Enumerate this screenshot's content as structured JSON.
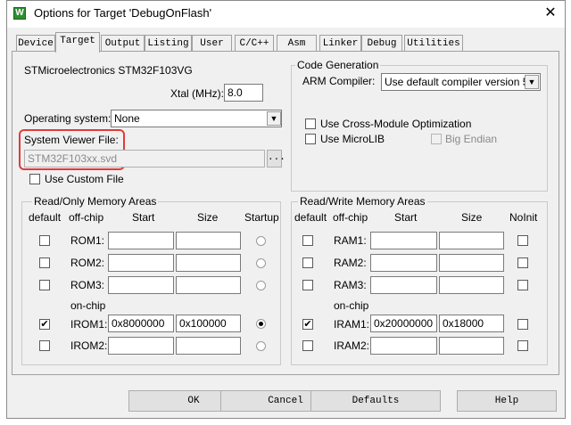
{
  "window": {
    "title": "Options for Target 'DebugOnFlash'",
    "close": "✕",
    "app_icon": "W"
  },
  "tabs": [
    {
      "label": "Device"
    },
    {
      "label": "Target"
    },
    {
      "label": "Output"
    },
    {
      "label": "Listing"
    },
    {
      "label": "User"
    },
    {
      "label": "C/C++"
    },
    {
      "label": "Asm"
    },
    {
      "label": "Linker"
    },
    {
      "label": "Debug"
    },
    {
      "label": "Utilities"
    }
  ],
  "device": {
    "name": "STMicroelectronics STM32F103VG",
    "xtal_label": "Xtal (MHz):",
    "xtal_value": "8.0"
  },
  "os": {
    "label": "Operating system:",
    "value": "None"
  },
  "svd": {
    "label": "System Viewer File:",
    "value": "STM32F103xx.svd",
    "browse": "...",
    "use_custom_label": "Use Custom File"
  },
  "codegen": {
    "title": "Code Generation",
    "compiler_label": "ARM Compiler:",
    "compiler_value": "Use default compiler version 5",
    "cross_module": "Use Cross-Module Optimization",
    "microlib": "Use MicroLIB",
    "big_endian": "Big Endian"
  },
  "ro": {
    "title": "Read/Only Memory Areas",
    "headers": {
      "default": "default",
      "offchip": "off-chip",
      "start": "Start",
      "size": "Size",
      "startup": "Startup"
    },
    "onchip": "on-chip",
    "rows": [
      {
        "name": "ROM1:",
        "start": "",
        "size": "",
        "checked": false,
        "startup": false
      },
      {
        "name": "ROM2:",
        "start": "",
        "size": "",
        "checked": false,
        "startup": false
      },
      {
        "name": "ROM3:",
        "start": "",
        "size": "",
        "checked": false,
        "startup": false
      },
      {
        "name": "IROM1:",
        "start": "0x8000000",
        "size": "0x100000",
        "checked": true,
        "startup": true
      },
      {
        "name": "IROM2:",
        "start": "",
        "size": "",
        "checked": false,
        "startup": false
      }
    ]
  },
  "rw": {
    "title": "Read/Write Memory Areas",
    "headers": {
      "default": "default",
      "offchip": "off-chip",
      "start": "Start",
      "size": "Size",
      "noinit": "NoInit"
    },
    "onchip": "on-chip",
    "rows": [
      {
        "name": "RAM1:",
        "start": "",
        "size": "",
        "checked": false
      },
      {
        "name": "RAM2:",
        "start": "",
        "size": "",
        "checked": false
      },
      {
        "name": "RAM3:",
        "start": "",
        "size": "",
        "checked": false
      },
      {
        "name": "IRAM1:",
        "start": "0x20000000",
        "size": "0x18000",
        "checked": true
      },
      {
        "name": "IRAM2:",
        "start": "",
        "size": "",
        "checked": false
      }
    ]
  },
  "buttons": {
    "ok": "OK",
    "cancel": "Cancel",
    "defaults": "Defaults",
    "help": "Help"
  },
  "colors": {
    "highlight": "#e03b3b",
    "dialog_bg": "#f0f0f0"
  }
}
